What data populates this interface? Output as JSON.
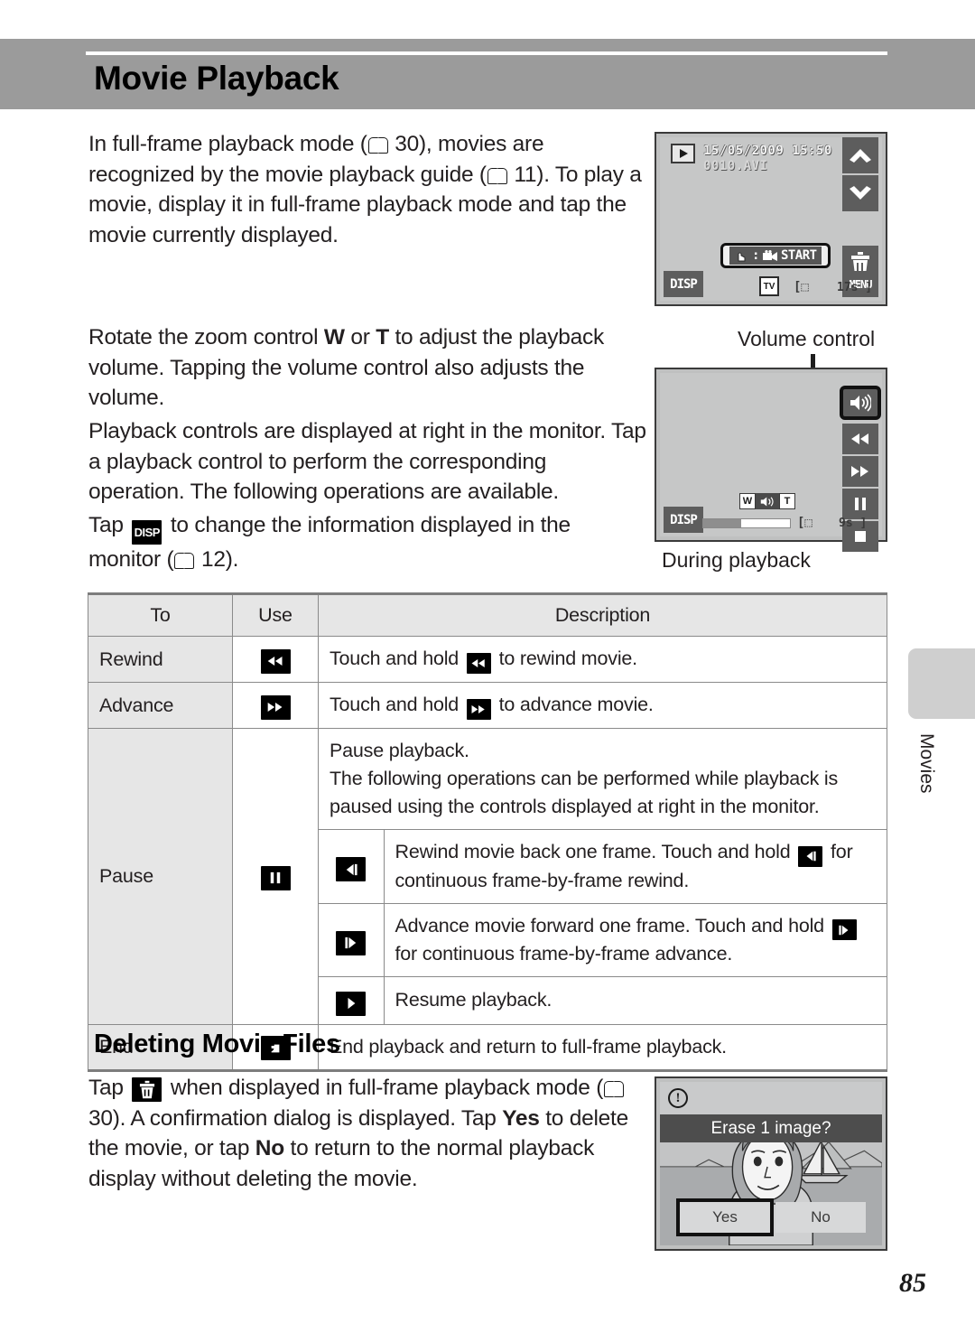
{
  "page": {
    "title": "Movie Playback",
    "number": "85",
    "side_tab_label": "Movies"
  },
  "paragraphs": {
    "p1_a": "In full-frame playback mode (",
    "p1_ref1": "30",
    "p1_b": "), movies are recognized by the movie playback guide (",
    "p1_ref2": "11",
    "p1_c": "). To play a movie, display it in full-frame playback mode and tap the movie currently displayed.",
    "p2_a": "Rotate the zoom control ",
    "p2_w": "W",
    "p2_or": " or ",
    "p2_t": "T",
    "p2_b": " to adjust the playback volume. Tapping the volume control also adjusts the volume.",
    "p3": "Playback controls are displayed at right in the monitor. Tap a playback control to perform the corresponding operation. The following operations are available.",
    "p4_a": "Tap ",
    "p4_icon": "DISP",
    "p4_b": " to change the information displayed in the monitor (",
    "p4_ref": "12",
    "p4_c": ")."
  },
  "section2": {
    "heading": "Deleting Movie Files",
    "a": "Tap ",
    "icon": "trash-icon",
    "b": " when displayed in full-frame playback mode (",
    "ref": "30",
    "c": "). A confirmation dialog is displayed. Tap ",
    "yes": "Yes",
    "d": " to delete the movie, or tap ",
    "no": "No",
    "e": " to return to the normal playback display without deleting the movie."
  },
  "shot1": {
    "date": "15/05/2009 15:50",
    "filename": "0010.AVI",
    "start_label": "START",
    "disp_label": "DISP",
    "menu_label": "MENU",
    "tv_label": "TV",
    "frame_mark": "[⬚",
    "time_remaining": "17s ]"
  },
  "shot2": {
    "callout": "Volume control",
    "caption": "During playback",
    "w_label": "W",
    "t_label": "T",
    "disp_label": "DISP",
    "frame_mark": "[⬚",
    "time_remaining": "9s ]"
  },
  "shot3": {
    "message": "Erase 1 image?",
    "yes_label": "Yes",
    "no_label": "No"
  },
  "table": {
    "headers": {
      "to": "To",
      "use": "Use",
      "description": "Description"
    },
    "rows": [
      {
        "to": "Rewind",
        "use_icon": "rewind-icon",
        "desc_a": "Touch and hold ",
        "desc_icon": "rewind-icon",
        "desc_b": " to rewind movie."
      },
      {
        "to": "Advance",
        "use_icon": "advance-icon",
        "desc_a": "Touch and hold ",
        "desc_icon": "advance-icon",
        "desc_b": " to advance movie."
      },
      {
        "to": "Pause",
        "use_icon": "pause-icon",
        "desc_line1": "Pause playback.",
        "desc_line2": "The following operations can be performed while playback is paused using the controls displayed at right in the monitor.",
        "sub_rows": [
          {
            "icon": "step-back-icon",
            "a": "Rewind movie back one frame. Touch and hold ",
            "b": " for continuous frame-by-frame rewind."
          },
          {
            "icon": "step-forward-icon",
            "a": "Advance movie forward one frame. Touch and hold ",
            "b": " for continuous frame-by-frame advance."
          },
          {
            "icon": "resume-icon",
            "a": "Resume playback.",
            "b": ""
          }
        ]
      },
      {
        "to": "End",
        "use_icon": "stop-icon",
        "desc_a": "End playback and return to full-frame playback.",
        "desc_icon": "",
        "desc_b": ""
      }
    ]
  },
  "colors": {
    "header_band": "#9b9b9b",
    "table_header_bg": "#e6e6e6",
    "monitor_bg": "#c6c7c7",
    "osd_chip": "#5d5d5d"
  }
}
